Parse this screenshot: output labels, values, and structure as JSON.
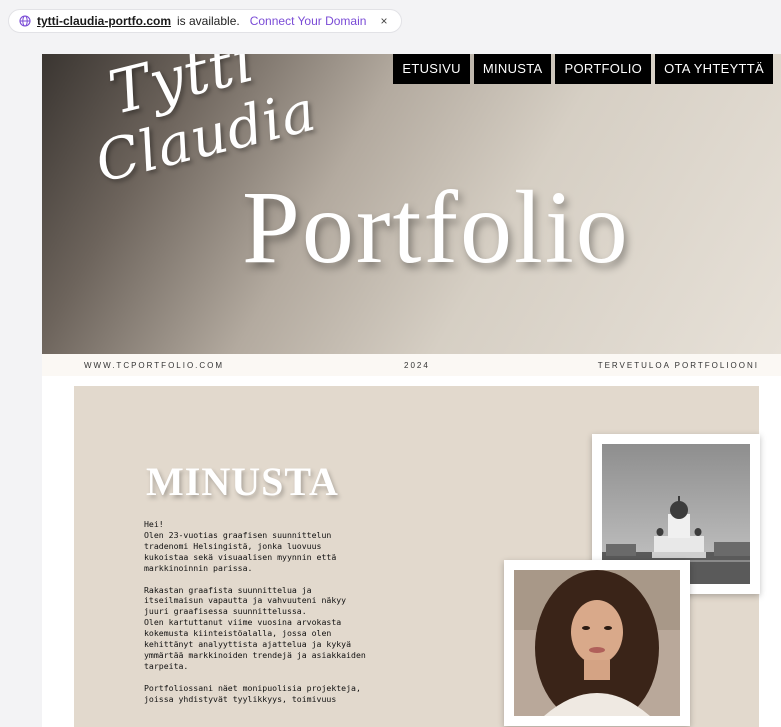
{
  "banner": {
    "domain": "tytti-claudia-portfo.com",
    "status_text": "is available.",
    "connect_label": "Connect Your Domain",
    "close_label": "×",
    "icons": {
      "globe": "globe-icon",
      "close": "close-icon"
    },
    "accent_color": "#7a4bd6"
  },
  "hero": {
    "script_line1": "Tytti",
    "script_line2": "Claudia",
    "big_word": "Portfolio"
  },
  "nav": {
    "items": [
      {
        "label": "ETUSIVU"
      },
      {
        "label": "MINUSTA"
      },
      {
        "label": "PORTFOLIO"
      },
      {
        "label": "OTA YHTEYTTÄ"
      }
    ]
  },
  "strip": {
    "website": "WWW.TCPORTFOLIO.COM",
    "year": "2024",
    "welcome": "TERVETULOA PORTFOLIOONI"
  },
  "about": {
    "heading": "MINUSTA",
    "paragraphs": [
      {
        "lines": [
          "Hei!",
          "Olen 23-vuotias graafisen suunnittelun",
          "tradenomi Helsingistä, jonka luovuus",
          "kukoistaa sekä visuaalisen myynnin että",
          "markkinoinnin parissa."
        ]
      },
      {
        "lines": [
          "Rakastan graafista suunnittelua ja",
          "itseilmaisun vapautta ja vahvuuteni näkyy",
          "juuri graafisessa suunnittelussa.",
          "Olen kartuttanut viime vuosina arvokasta",
          "kokemusta kiinteistöalalla, jossa olen",
          "kehittänyt analyyttista ajattelua ja kykyä",
          "ymmärtää markkinoiden trendejä ja asiakkaiden",
          "tarpeita."
        ]
      },
      {
        "lines": [
          "Portfoliossani näet monipuolisia projekteja,",
          "joissa yhdistyvät tyylikkyys, toimivuus"
        ]
      }
    ]
  }
}
